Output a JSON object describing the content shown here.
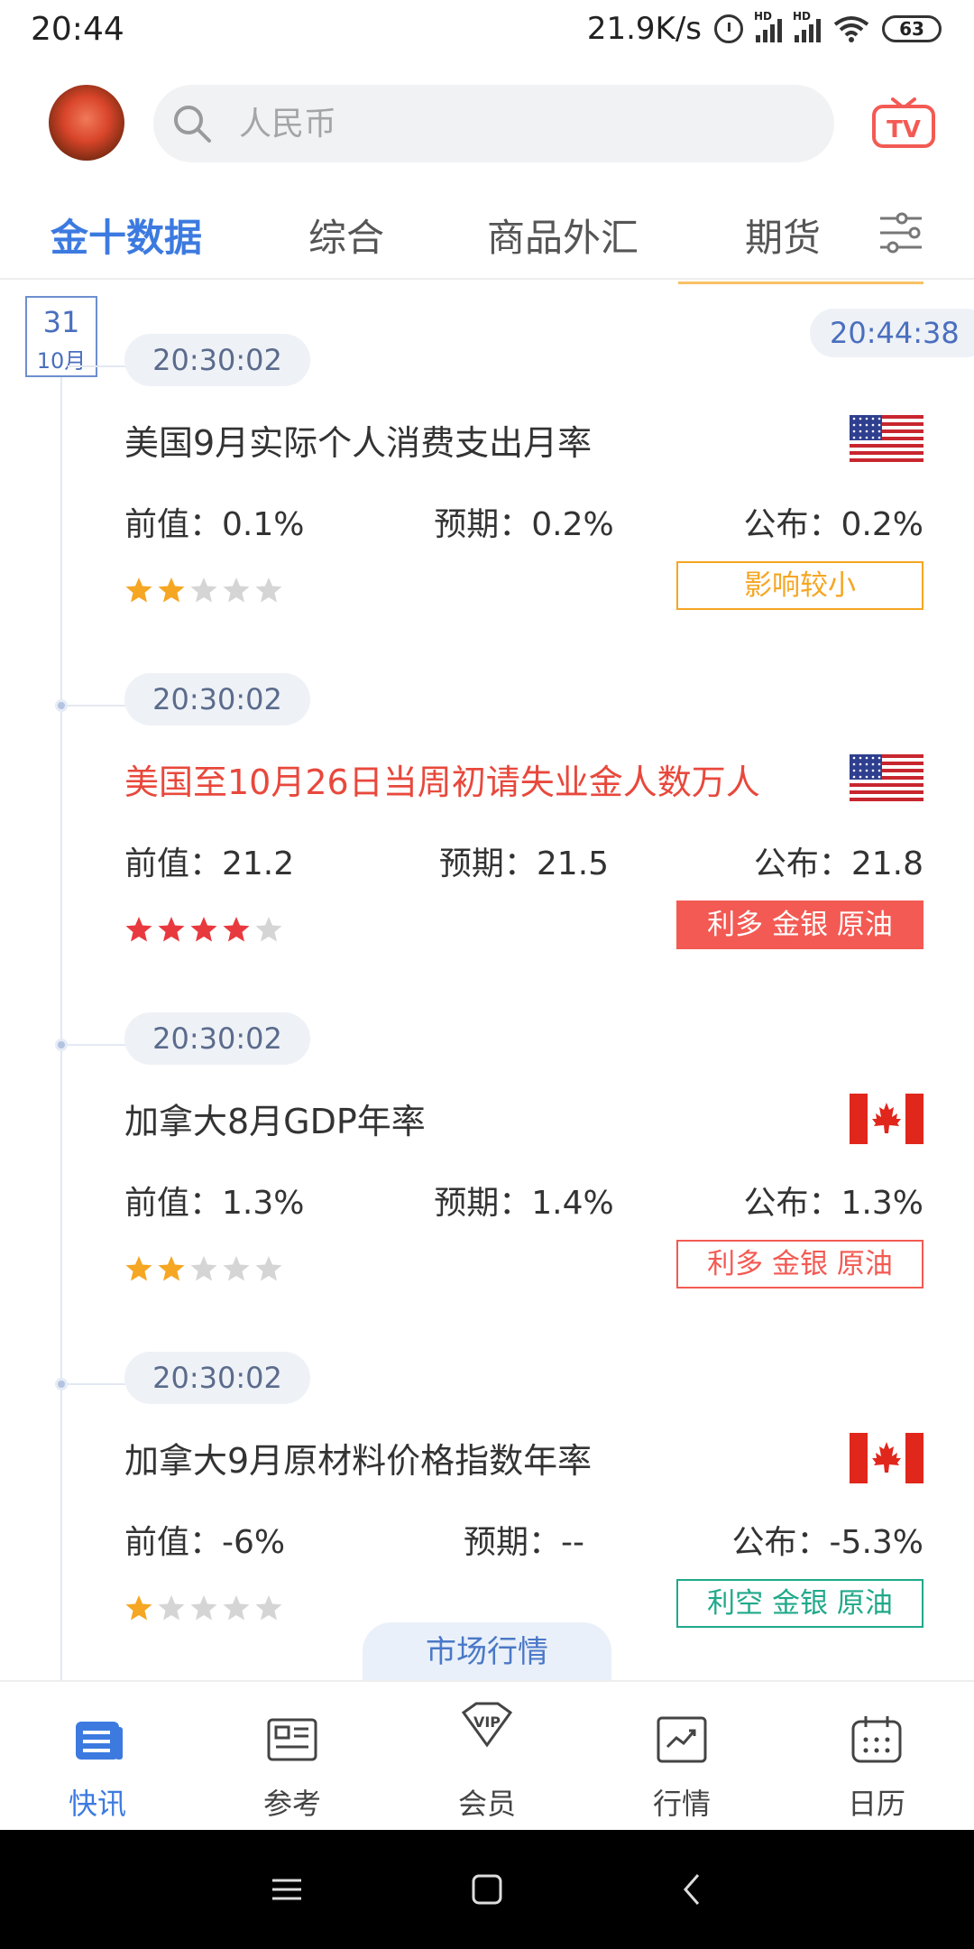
{
  "status_bar": {
    "time": "20:44",
    "net_speed": "21.9K/s",
    "battery": "63"
  },
  "header": {
    "search_placeholder": "人民币"
  },
  "tabs": [
    {
      "label": "金十数据"
    },
    {
      "label": "综合"
    },
    {
      "label": "商品外汇"
    },
    {
      "label": "期货"
    }
  ],
  "feed": {
    "date_day": "31",
    "date_month": "10月",
    "current_time": "20:44:38",
    "entries": [
      {
        "time": "20:30:02",
        "title": "美国9月实际个人消费支出月率",
        "flag": "us-flag",
        "prev": "前值：0.1%",
        "expected": "预期：0.2%",
        "actual": "公布：0.2%",
        "stars": 2,
        "badge": "影响较小"
      },
      {
        "time": "20:30:02",
        "title": "美国至10月26日当周初请失业金人数万人",
        "flag": "us-flag",
        "prev": "前值：21.2",
        "expected": "预期：21.5",
        "actual": "公布：21.8",
        "stars": 4,
        "badge": "利多 金银 原油"
      },
      {
        "time": "20:30:02",
        "title": "加拿大8月GDP年率",
        "flag": "canada-flag",
        "prev": "前值：1.3%",
        "expected": "预期：1.4%",
        "actual": "公布：1.3%",
        "stars": 2,
        "badge": "利多 金银 原油"
      },
      {
        "time": "20:30:02",
        "title": "加拿大9月原材料价格指数年率",
        "flag": "canada-flag",
        "prev": "前值：-6%",
        "expected": "预期：--",
        "actual": "公布：-5.3%",
        "stars": 1,
        "badge": "利空 金银 原油"
      }
    ],
    "market_button": "市场行情"
  },
  "bottom_nav": [
    {
      "label": "快讯",
      "icon": "news-icon"
    },
    {
      "label": "参考",
      "icon": "reference-icon"
    },
    {
      "label": "会员",
      "icon": "vip-icon"
    },
    {
      "label": "行情",
      "icon": "chart-icon"
    },
    {
      "label": "日历",
      "icon": "calendar-icon"
    }
  ],
  "colors": {
    "accent": "#3c7ae0",
    "star_gold": "#f5a623",
    "star_red": "#e8393f",
    "bullish_red": "#f35a53",
    "bearish_green": "#20a98a",
    "minor_orange": "#f5a623"
  }
}
